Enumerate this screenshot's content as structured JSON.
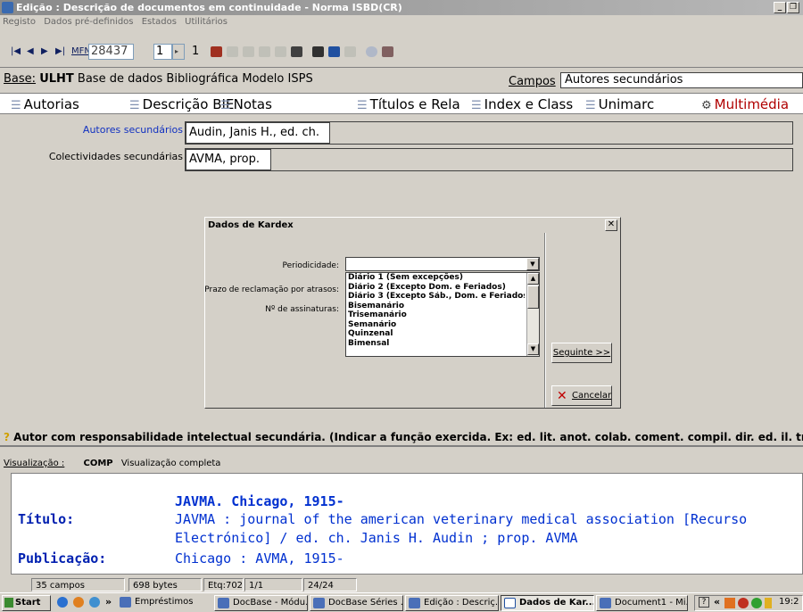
{
  "window": {
    "title": "Edição : Descrição de documentos em continuidade - Norma ISBD(CR)",
    "min_icon": "_",
    "restore_icon": "❐"
  },
  "menu": [
    "Registo",
    "Dados pré-definidos",
    "Estados",
    "Utilitários"
  ],
  "toolbar": {
    "mfn_label": "MFN",
    "mfn_value": "28437",
    "record_value": "1",
    "record_total": "1"
  },
  "basebar": {
    "base_label": "Base:",
    "base_value": "ULHT",
    "base_name": "Base de dados Bibliográfica",
    "modelo_label": "Modelo",
    "modelo_value": "ISPS",
    "campos_label": "Campos",
    "campos_value": "Autores secundários"
  },
  "tabs": [
    "Autorias",
    "Descrição BIE",
    "Notas",
    "Títulos e Rela",
    "Index e Class",
    "Unimarc",
    "Multimédia"
  ],
  "fields": [
    {
      "label": "Autores secundários",
      "value": "Audin, Janis H., ed. ch."
    },
    {
      "label": "Colectividades secundárias",
      "value": "AVMA, prop."
    }
  ],
  "dialog": {
    "title": "Dados de Kardex",
    "close": "✕",
    "labels": {
      "periodicidade": "Periodicidade:",
      "prazo": "Prazo de reclamação por atrasos:",
      "assinaturas": "Nº de assinaturas:"
    },
    "options": [
      "Diário 1 (Sem excepções)",
      "Diário 2 (Excepto Dom. e Feriados)",
      "Diário 3 (Excepto Sáb., Dom. e Feriados)",
      "Bisemanário",
      "Trisemanário",
      "Semanário",
      "Quinzenal",
      "Bimensal"
    ],
    "next_button": "Seguinte >>",
    "cancel_button": "Cancelar"
  },
  "hint": "Autor com responsabilidade intelectual secundária. (Indicar a função exercida. Ex: ed. lit.  anot.  colab.  coment.  compil.  dir.  ed.  il.  trad.",
  "visualizacao": {
    "label": "Visualização :",
    "mode": "COMP",
    "mode_desc": "Visualização completa"
  },
  "preview": {
    "heading": "JAVMA. Chicago, 1915-",
    "titulo_label": "Título:",
    "titulo_line1": "JAVMA : journal of the american veterinary medical association [Recurso",
    "titulo_line2": "Electrónico] / ed. ch. Janis H. Audin ; prop. AVMA",
    "publicacao_label": "Publicação:",
    "publicacao_value": "Chicago : AVMA, 1915-"
  },
  "status": {
    "campos": "35 campos",
    "bytes": "698 bytes",
    "etq": "Etq:702",
    "page": "1/1",
    "count": "24/24"
  },
  "taskbar": {
    "start": "Start",
    "items": [
      "Empréstimos",
      "DocBase - Módu...",
      "DocBase Séries ...",
      "Edição : Descriç...",
      "Dados de Kar...",
      "Document1 - Mi..."
    ],
    "clock": "19:2"
  }
}
